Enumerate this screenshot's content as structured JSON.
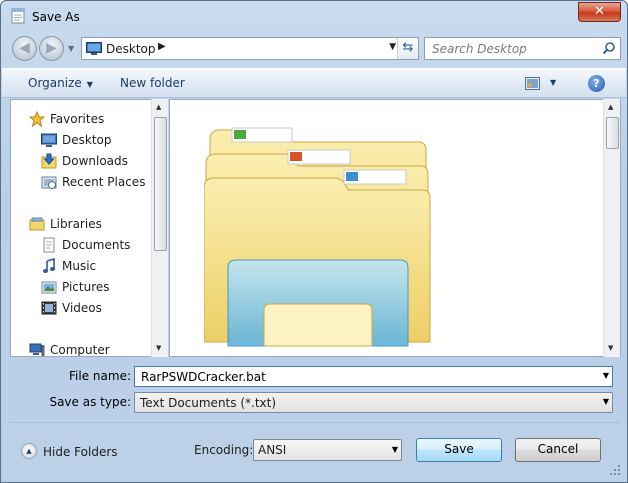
{
  "window": {
    "title": "Save As",
    "close_label": "✕"
  },
  "nav": {
    "back_glyph": "◀",
    "forward_glyph": "▶",
    "address": "Desktop",
    "address_chevron": "▶",
    "search_placeholder": "Search Desktop"
  },
  "toolbar": {
    "organize_label": "Organize",
    "new_folder_label": "New folder",
    "help_label": "?"
  },
  "sidebar": {
    "favorites": {
      "label": "Favorites",
      "icon": "star-icon"
    },
    "favorites_items": [
      {
        "label": "Desktop",
        "icon": "desktop-icon"
      },
      {
        "label": "Downloads",
        "icon": "downloads-icon"
      },
      {
        "label": "Recent Places",
        "icon": "recent-places-icon"
      }
    ],
    "libraries": {
      "label": "Libraries",
      "icon": "libraries-icon"
    },
    "libraries_items": [
      {
        "label": "Documents",
        "icon": "documents-icon"
      },
      {
        "label": "Music",
        "icon": "music-icon"
      },
      {
        "label": "Pictures",
        "icon": "pictures-icon"
      },
      {
        "label": "Videos",
        "icon": "videos-icon"
      }
    ],
    "computer": {
      "label": "Computer",
      "icon": "computer-icon"
    }
  },
  "form": {
    "filename_label": "File name:",
    "filename_value": "RarPSWDCracker.bat",
    "savetype_label": "Save as type:",
    "savetype_value": "Text Documents (*.txt)"
  },
  "footer": {
    "hide_folders_label": "Hide Folders",
    "encoding_label": "Encoding:",
    "encoding_value": "ANSI",
    "save_label": "Save",
    "cancel_label": "Cancel"
  },
  "colors": {
    "accent": "#3c7fb1",
    "frame": "#b9cfe7",
    "folder_yellow": "#f2d66e",
    "folder_blue": "#7dc3e8",
    "close_red": "#c5381b"
  }
}
